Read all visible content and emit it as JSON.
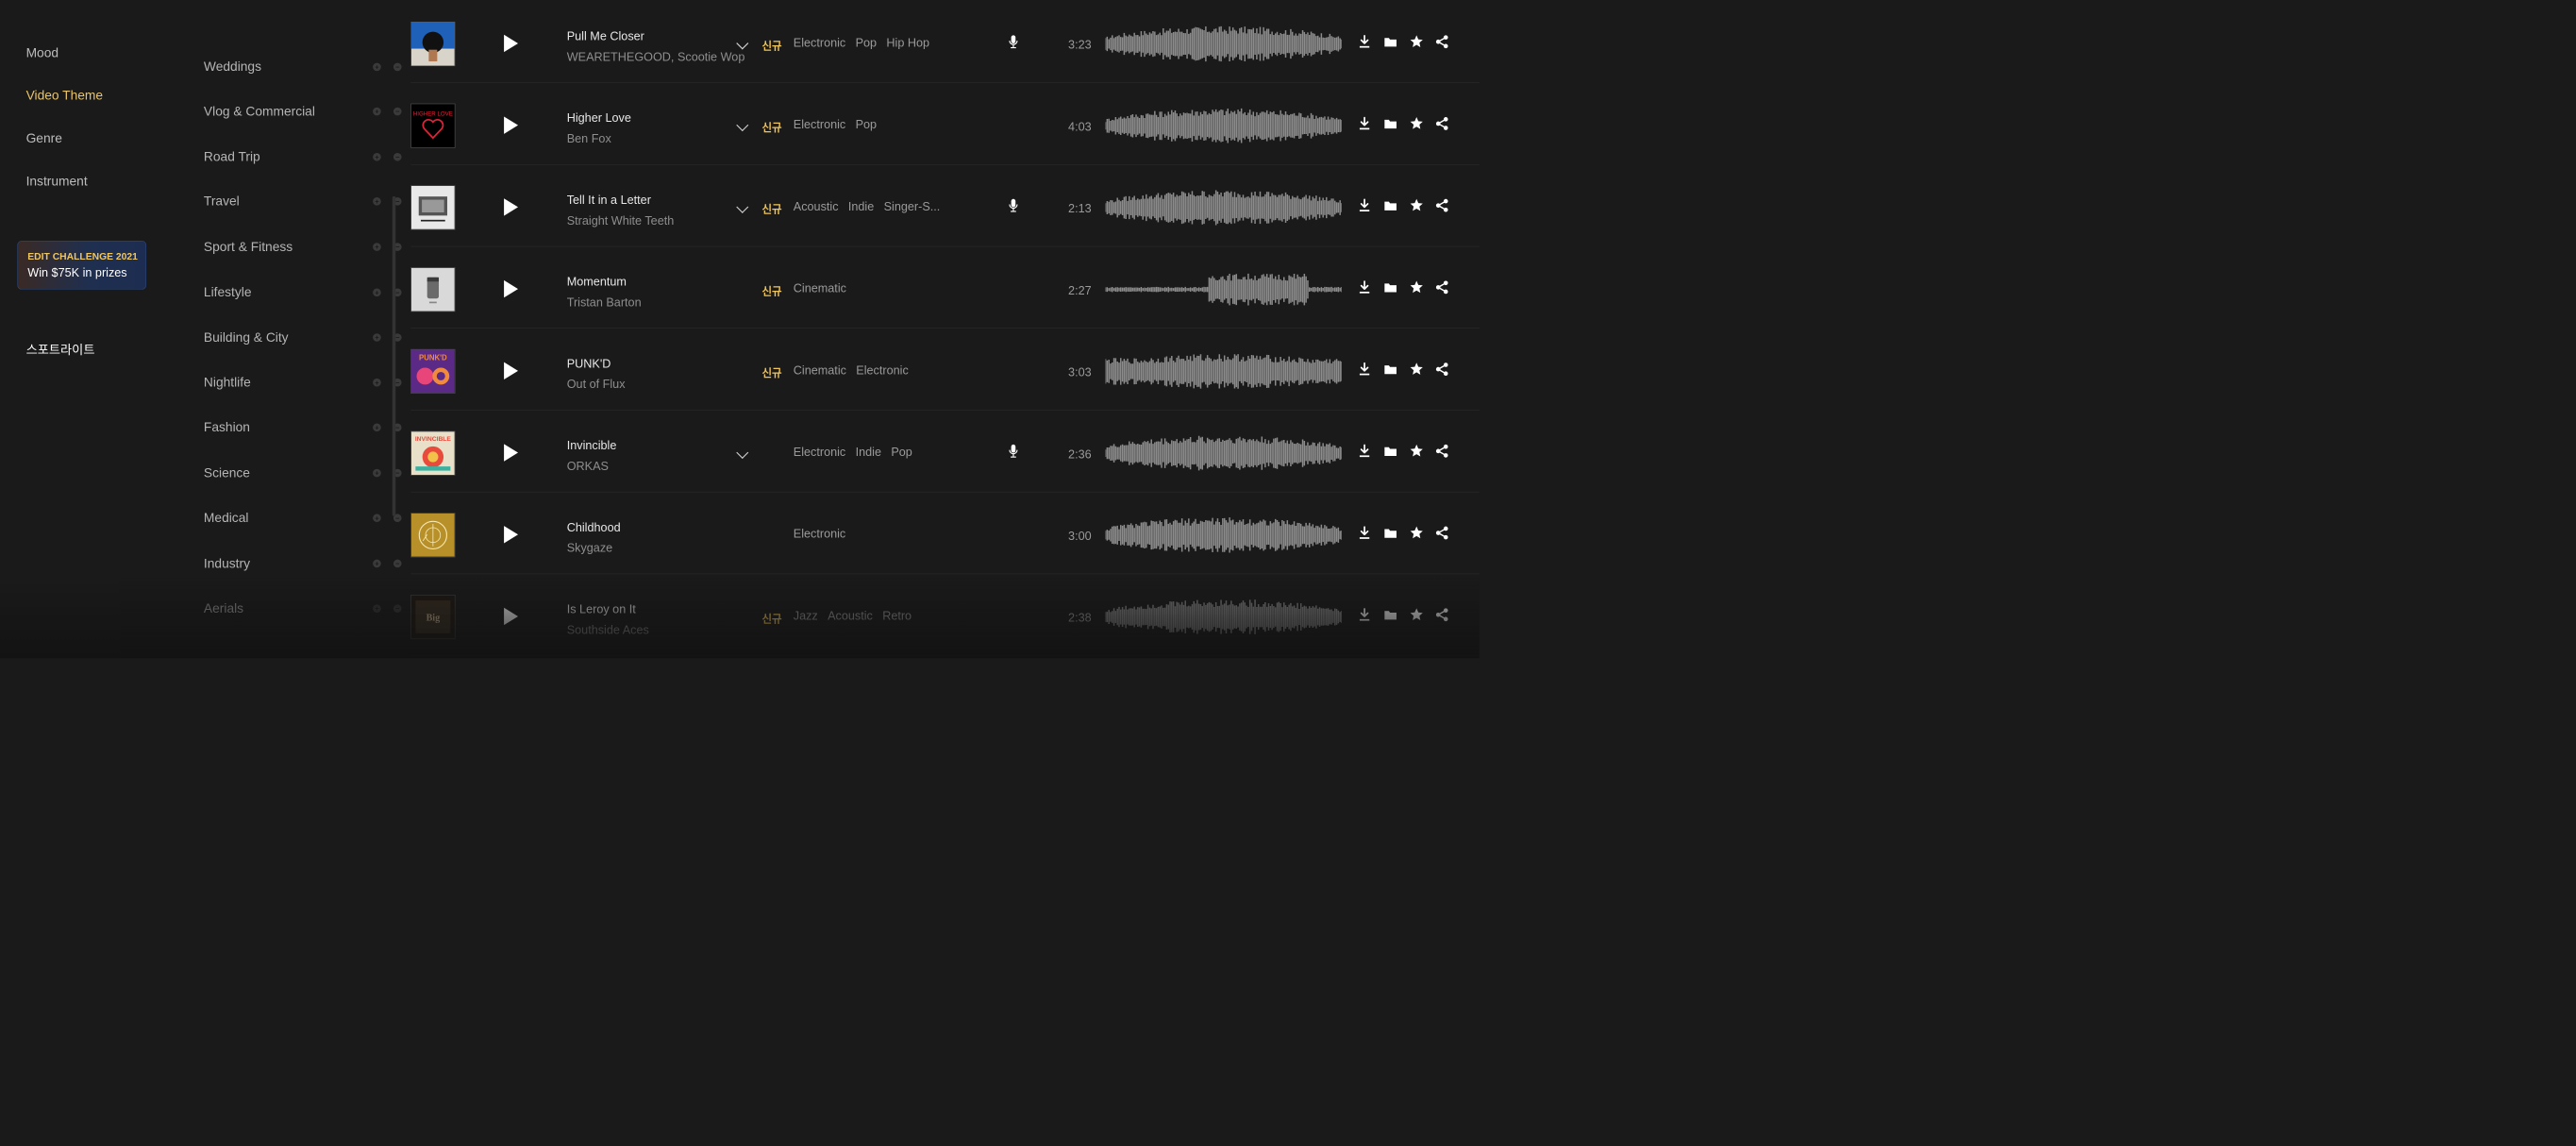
{
  "sidebar": {
    "categories": [
      {
        "label": "Mood"
      },
      {
        "label": "Video Theme",
        "active": true
      },
      {
        "label": "Genre"
      },
      {
        "label": "Instrument"
      }
    ],
    "promo": {
      "line1": "EDIT CHALLENGE 2021",
      "line2": "Win $75K in prizes"
    },
    "spotlight": "스포트라이트"
  },
  "subcategories": [
    {
      "label": "Weddings"
    },
    {
      "label": "Vlog & Commercial"
    },
    {
      "label": "Road Trip"
    },
    {
      "label": "Travel"
    },
    {
      "label": "Sport & Fitness"
    },
    {
      "label": "Lifestyle"
    },
    {
      "label": "Building & City"
    },
    {
      "label": "Nightlife"
    },
    {
      "label": "Fashion"
    },
    {
      "label": "Science"
    },
    {
      "label": "Medical"
    },
    {
      "label": "Industry"
    },
    {
      "label": "Aerials"
    }
  ],
  "tracks": [
    {
      "title": "Pull Me Closer",
      "artist": "WEARETHEGOOD, Scootie Wop",
      "new": "신규",
      "tags": [
        "Electronic",
        "Pop",
        "Hip Hop"
      ],
      "vocals": true,
      "duration": "3:23",
      "expand": true,
      "art": [
        "#1f60b8",
        "#d8d4c9"
      ]
    },
    {
      "title": "Higher Love",
      "artist": "Ben Fox",
      "new": "신규",
      "tags": [
        "Electronic",
        "Pop"
      ],
      "vocals": false,
      "duration": "4:03",
      "expand": true,
      "art": [
        "#000000",
        "#e0243a"
      ],
      "art_text": "HIGHER LOVE"
    },
    {
      "title": "Tell It in a Letter",
      "artist": "Straight White Teeth",
      "new": "신규",
      "tags": [
        "Acoustic",
        "Indie",
        "Singer-S..."
      ],
      "vocals": true,
      "duration": "2:13",
      "expand": true,
      "art": [
        "#e8e8e8",
        "#222222"
      ]
    },
    {
      "title": "Momentum",
      "artist": "Tristan Barton",
      "new": "신규",
      "tags": [
        "Cinematic"
      ],
      "vocals": false,
      "duration": "2:27",
      "expand": false,
      "art": [
        "#d9d9d9",
        "#3a3a3a"
      ]
    },
    {
      "title": "PUNK'D",
      "artist": "Out of Flux",
      "new": "신규",
      "tags": [
        "Cinematic",
        "Electronic"
      ],
      "vocals": false,
      "duration": "3:03",
      "expand": false,
      "art": [
        "#5b2a87",
        "#f08a3c"
      ],
      "art_text": "PUNK'D"
    },
    {
      "title": "Invincible",
      "artist": "ORKAS",
      "new": "",
      "tags": [
        "Electronic",
        "Indie",
        "Pop"
      ],
      "vocals": true,
      "duration": "2:36",
      "expand": true,
      "art": [
        "#e8e0c8",
        "#e84a3c"
      ],
      "art_text": "INVINCIBLE"
    },
    {
      "title": "Childhood",
      "artist": "Skygaze",
      "new": "",
      "tags": [
        "Electronic"
      ],
      "vocals": false,
      "duration": "3:00",
      "expand": false,
      "art": [
        "#b8902a",
        "#f5e6b0"
      ]
    },
    {
      "title": "Is Leroy on It",
      "artist": "Southside Aces",
      "new": "신규",
      "tags": [
        "Jazz",
        "Acoustic",
        "Retro"
      ],
      "vocals": false,
      "duration": "2:38",
      "expand": false,
      "art": [
        "#1e1712",
        "#c9b48a"
      ]
    }
  ],
  "icons": {
    "download": "download-icon",
    "folder": "folder-icon",
    "favorite": "star-icon",
    "share": "share-icon",
    "vocals": "microphone-icon",
    "play": "play-icon",
    "expand": "chevron-down-icon"
  },
  "colors": {
    "accent": "#f1c65a",
    "background": "#1a1a1a",
    "text_muted": "#9a9a9a"
  }
}
